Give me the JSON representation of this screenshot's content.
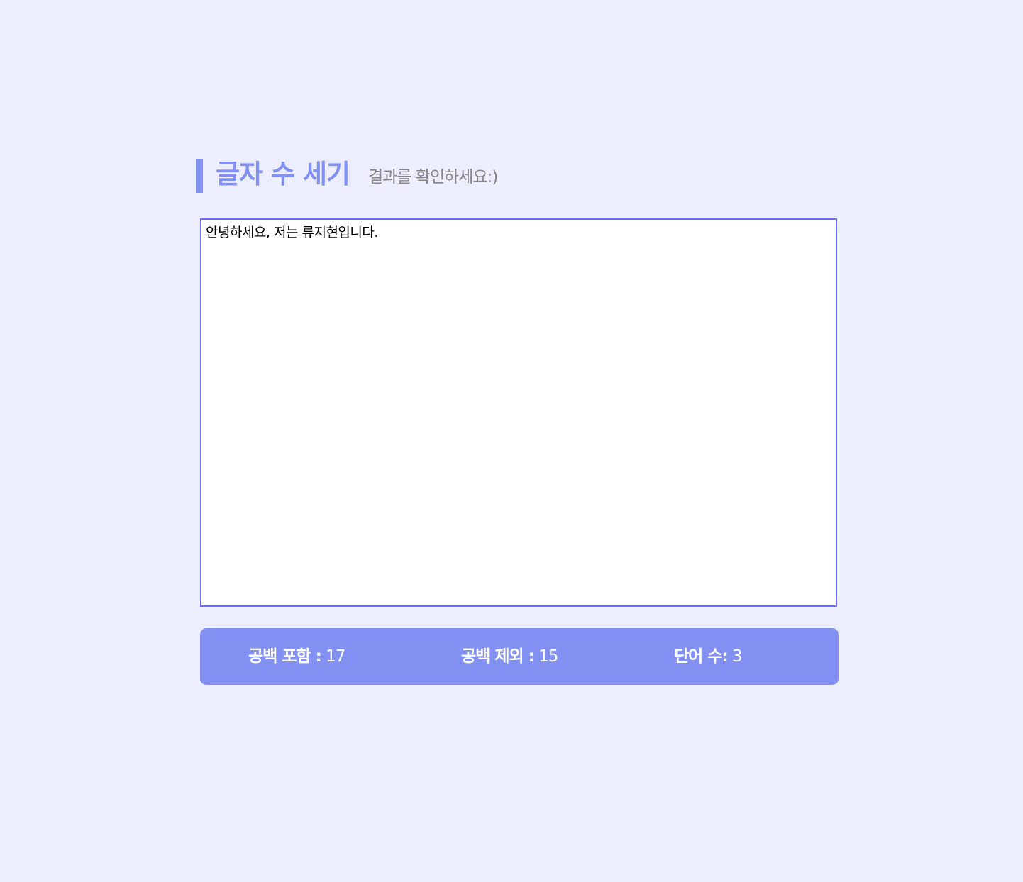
{
  "header": {
    "title": "글자 수 세기",
    "subtitle": "결과를 확인하세요:)"
  },
  "editor": {
    "value": "안녕하세요, 저는 류지현입니다."
  },
  "stats": [
    {
      "label": "공백 포함 :",
      "value": "17"
    },
    {
      "label": "공백 제외 :",
      "value": "15"
    },
    {
      "label": "단어 수:",
      "value": "3"
    }
  ],
  "colors": {
    "background": "#eceefd",
    "accent": "#8291f1",
    "editor_border": "#6b6bee",
    "subtitle": "#868686"
  }
}
